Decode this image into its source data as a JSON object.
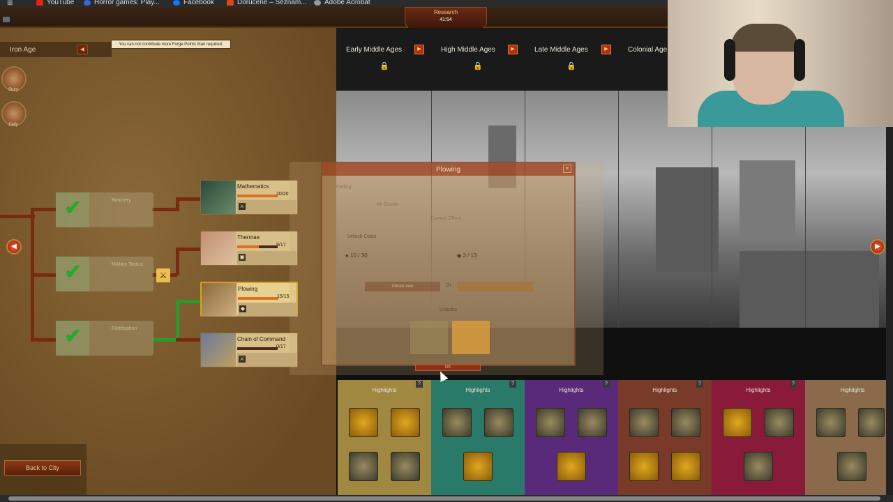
{
  "bookmarks": [
    {
      "label": "YouTube",
      "color": "#e62117"
    },
    {
      "label": "Horror games: Play...",
      "color": "#3a6ad8"
    },
    {
      "label": "Facebook",
      "color": "#1877f2"
    },
    {
      "label": "Doručené – Seznam...",
      "color": "#d84a1a"
    },
    {
      "label": "Adobe Acrobat",
      "color": "#9a9a9a"
    }
  ],
  "research_tab": {
    "title": "Research",
    "value": "41:54"
  },
  "current_age": "Iron Age",
  "tooltip": "You can not contribute more Forge Points than required.",
  "side_buttons": [
    {
      "label": "Story"
    },
    {
      "label": "Daily"
    }
  ],
  "completed_techs": [
    "Butchery",
    "Military Tactics",
    "Fortification"
  ],
  "techs": [
    {
      "name": "Mathematics",
      "progress": "20/20",
      "fraction": 1.0
    },
    {
      "name": "Thermae",
      "progress": "9/17",
      "fraction": 0.53
    },
    {
      "name": "Plowing",
      "progress": "15/15",
      "fraction": 1.0
    },
    {
      "name": "Chain of Command",
      "progress": "0/17",
      "fraction": 0.0
    }
  ],
  "eras": [
    {
      "label": "Early Middle Ages"
    },
    {
      "label": "High Middle Ages"
    },
    {
      "label": "Late Middle Ages"
    },
    {
      "label": "Colonial Age"
    }
  ],
  "highlights_label": "Highlights",
  "modal": {
    "title": "Plowing",
    "unlock_costs_label": "Unlock Costs",
    "fp_cost": "10 / 30",
    "goods_cost": "3 / 13",
    "unlock_now": "Unlock now",
    "or_label": "Or",
    "unlocks_label": "Unlocks",
    "current_offers": "Current Offers",
    "trading_tab": "Trading",
    "filter_label": "All Goods",
    "ok": "OK"
  },
  "back_button": "Back to City"
}
